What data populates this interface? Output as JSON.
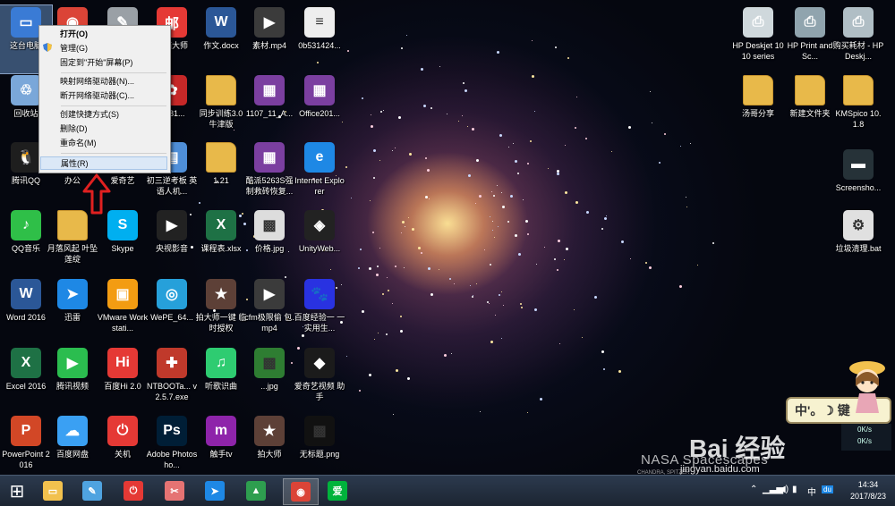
{
  "desktop": {
    "icons": [
      {
        "label": "这台电脑",
        "icon": "computer-icon",
        "color": "#3a7bd5"
      },
      {
        "label": "",
        "icon": "chrome-icon",
        "color": "#db4437"
      },
      {
        "label": "",
        "icon": "tool-icon",
        "color": "#9aa0a6"
      },
      {
        "label": "邮箱大师",
        "icon": "mail-master-icon",
        "color": "#e53935"
      },
      {
        "label": "作文.docx",
        "icon": "word-doc-icon",
        "color": "#2b5797"
      },
      {
        "label": "素材.mp4",
        "icon": "video-file-icon",
        "color": "#3b3b3b"
      },
      {
        "label": "0b531424...",
        "icon": "document-icon",
        "color": "#eeeeee"
      },
      {
        "label": "回收站",
        "icon": "recycle-bin-icon",
        "color": "#7aa7d9"
      },
      {
        "label": "C881...",
        "icon": "huawei-icon",
        "color": "#c62828"
      },
      {
        "label": "同步训练3.0 牛津版",
        "icon": "folder-icon",
        "color": "#e8b94a"
      },
      {
        "label": "1107_11_A...",
        "icon": "winrar-icon",
        "color": "#7b3fa0"
      },
      {
        "label": "Office201...",
        "icon": "winrar-icon",
        "color": "#7b3fa0"
      },
      {
        "label": "腾讯QQ",
        "icon": "qq-icon",
        "color": "#1e1e1e"
      },
      {
        "label": "办公",
        "icon": "folder-icon",
        "color": "#e8b94a"
      },
      {
        "label": "爱奇艺",
        "icon": "iqiyi-icon",
        "color": "#00b33c"
      },
      {
        "label": "初三逆考板 英语人机...",
        "icon": "app-icon",
        "color": "#4f8fd8"
      },
      {
        "label": "1.21",
        "icon": "folder-icon",
        "color": "#e8b94a"
      },
      {
        "label": "酷派5263S强 制救砖恢复...",
        "icon": "winrar-icon",
        "color": "#7b3fa0"
      },
      {
        "label": "Internet Explorer",
        "icon": "ie-icon",
        "color": "#1e88e5"
      },
      {
        "label": "QQ音乐",
        "icon": "qq-music-icon",
        "color": "#2fbf48"
      },
      {
        "label": "月落风起 叶坠莲绽",
        "icon": "folder-icon",
        "color": "#e8b94a"
      },
      {
        "label": "Skype",
        "icon": "skype-icon",
        "color": "#00aff0"
      },
      {
        "label": "央视影音",
        "icon": "cntv-icon",
        "color": "#222222"
      },
      {
        "label": "课程表.xlsx",
        "icon": "excel-doc-icon",
        "color": "#1e7145"
      },
      {
        "label": "价格.jpg",
        "icon": "image-file-icon",
        "color": "#dddddd"
      },
      {
        "label": "UnityWeb...",
        "icon": "unity-icon",
        "color": "#222222"
      },
      {
        "label": "Word 2016",
        "icon": "word-icon",
        "color": "#2b5797"
      },
      {
        "label": "迅雷",
        "icon": "thunder-icon",
        "color": "#1e88e5"
      },
      {
        "label": "VMware Workstati...",
        "icon": "vmware-icon",
        "color": "#f39c12"
      },
      {
        "label": "WePE_64...",
        "icon": "disc-icon",
        "color": "#26a0da"
      },
      {
        "label": "拍大师一键 临时授权",
        "icon": "paidashi-icon",
        "color": "#5d4037"
      },
      {
        "label": "cfm极限偷 包.mp4",
        "icon": "video-file-icon",
        "color": "#3b3b3b"
      },
      {
        "label": "百度经验一 一实用生...",
        "icon": "baidu-paw-icon",
        "color": "#2932e1"
      },
      {
        "label": "Excel 2016",
        "icon": "excel-icon",
        "color": "#1e7145"
      },
      {
        "label": "腾讯视频",
        "icon": "tencent-video-icon",
        "color": "#2bbd4f"
      },
      {
        "label": "百度Hi 2.0",
        "icon": "baidu-hi-icon",
        "color": "#e53935"
      },
      {
        "label": "NTBOOTa... v2.5.7.exe",
        "icon": "toolbox-icon",
        "color": "#c0392b"
      },
      {
        "label": "听歌识曲",
        "icon": "music-recognize-icon",
        "color": "#2ecc71"
      },
      {
        "label": "...jpg",
        "icon": "image-file-icon",
        "color": "#2e7d32"
      },
      {
        "label": "爱奇艺视频 助手",
        "icon": "iqiyi-assistant-icon",
        "color": "#1b1b1b"
      },
      {
        "label": "PowerPoint 2016",
        "icon": "powerpoint-icon",
        "color": "#d24726"
      },
      {
        "label": "百度网盘",
        "icon": "baidu-netdisk-icon",
        "color": "#3aa0f3"
      },
      {
        "label": "关机",
        "icon": "power-icon",
        "color": "#e53935"
      },
      {
        "label": "Adobe Photosho...",
        "icon": "photoshop-icon",
        "color": "#001e36"
      },
      {
        "label": "触手tv",
        "icon": "chushou-icon",
        "color": "#8e24aa"
      },
      {
        "label": "拍大师",
        "icon": "paidashi-icon",
        "color": "#5d4037"
      },
      {
        "label": "无标题.png",
        "icon": "image-file-icon",
        "color": "#111111"
      },
      {
        "label": "HP Deskjet 1010 series",
        "icon": "printer-icon",
        "color": "#cfd8dc"
      },
      {
        "label": "HP Print and Sc...",
        "icon": "printer-scan-icon",
        "color": "#90a4ae"
      },
      {
        "label": "购买耗材 - HP Deskj...",
        "icon": "printer-icon",
        "color": "#b0bec5"
      },
      {
        "label": "汤哥分享",
        "icon": "folder-icon",
        "color": "#e8b94a"
      },
      {
        "label": "新建文件夹",
        "icon": "folder-icon",
        "color": "#e8b94a"
      },
      {
        "label": "KMSpico 10.1.8",
        "icon": "folder-icon",
        "color": "#e8b94a"
      },
      {
        "label": "Screensho...",
        "icon": "screenshot-icon",
        "color": "#263238"
      },
      {
        "label": "垃圾清理.bat",
        "icon": "bat-file-icon",
        "color": "#e0e0e0"
      }
    ]
  },
  "context_menu": {
    "items": [
      {
        "label": "打开(O)",
        "bold": true
      },
      {
        "label": "管理(G)",
        "bold": false
      },
      {
        "label": "固定到\"开始\"屏幕(P)",
        "bold": false
      },
      {
        "label": "映射网络驱动器(N)...",
        "bold": false
      },
      {
        "label": "断开网络驱动器(C)...",
        "bold": false
      },
      {
        "label": "创建快捷方式(S)",
        "bold": false
      },
      {
        "label": "删除(D)",
        "bold": false
      },
      {
        "label": "重命名(M)",
        "bold": false
      },
      {
        "label": "属性(R)",
        "bold": false
      }
    ],
    "highlighted": "属性(R)"
  },
  "taskbar": {
    "apps": [
      "start-icon",
      "file-explorer-icon",
      "paint-icon",
      "power-app-icon",
      "snipping-icon",
      "thunder-icon",
      "green-app-icon",
      "chrome-icon",
      "iqiyi-icon"
    ],
    "tray": {
      "ime_label": "中",
      "ime_badge": "du"
    },
    "clock": {
      "time": "14:34",
      "date": "2017/8/23"
    }
  },
  "overlays": {
    "ime_bar_text": "中'。☽ 键",
    "net_up": "0K/s",
    "net_down": "0K/s",
    "watermark_logo": "Bai 经验",
    "watermark_url": "jingyan.baidu.com",
    "nasa_text": "NASA Spacescapes",
    "chandra_text": "CHANDRA, SPITZER"
  },
  "colors": {
    "highlight": "#dbe8f7",
    "taskbar": "#243042",
    "arrow": "#e02020"
  }
}
